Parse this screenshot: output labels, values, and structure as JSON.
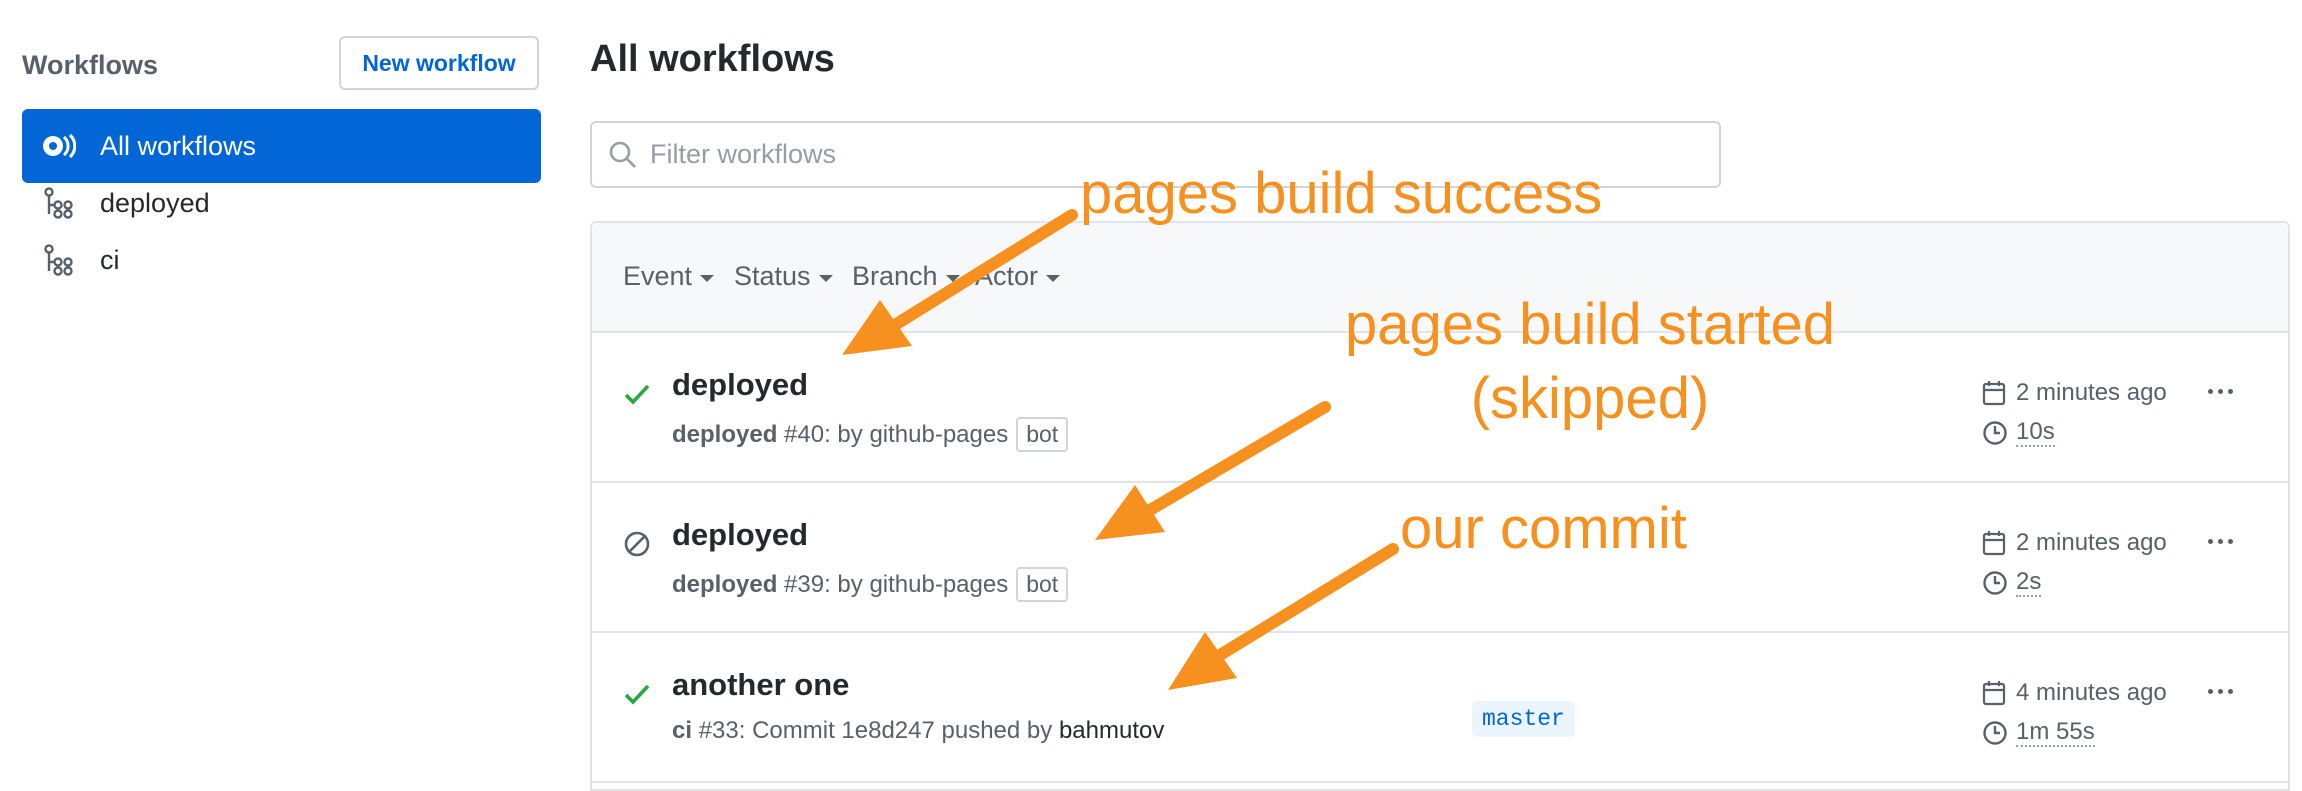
{
  "sidebar": {
    "title": "Workflows",
    "new_workflow_label": "New workflow",
    "items": [
      {
        "label": "All workflows",
        "icon": "workflows-icon",
        "active": true
      },
      {
        "label": "deployed",
        "icon": "workflow-icon",
        "active": false
      },
      {
        "label": "ci",
        "icon": "workflow-icon",
        "active": false
      }
    ]
  },
  "main": {
    "title": "All workflows",
    "filter_placeholder": "Filter workflows",
    "filters": [
      "Event",
      "Status",
      "Branch",
      "Actor"
    ],
    "runs": [
      {
        "status": "success",
        "title": "deployed",
        "workflow": "deployed",
        "run_number": "#40",
        "meta_text": ": by ",
        "actor": "github-pages",
        "badge": "bot",
        "branch": "",
        "time_ago": "2 minutes ago",
        "duration": "10s"
      },
      {
        "status": "skipped",
        "title": "deployed",
        "workflow": "deployed",
        "run_number": "#39",
        "meta_text": ": by ",
        "actor": "github-pages",
        "badge": "bot",
        "branch": "",
        "time_ago": "2 minutes ago",
        "duration": "2s"
      },
      {
        "status": "success",
        "title": "another one",
        "workflow": "ci",
        "run_number": "#33",
        "meta_text": ": Commit ",
        "commit": "1e8d247",
        "pushed_by_text": " pushed by ",
        "actor": "bahmutov",
        "badge": "",
        "branch": "master",
        "time_ago": "4 minutes ago",
        "duration": "1m 55s"
      }
    ]
  },
  "annotations": {
    "a1": "pages build success",
    "a2_line1": "pages build started",
    "a2_line2": "(skipped)",
    "a3": "our commit"
  },
  "colors": {
    "accent": "#0366d6",
    "success": "#28a745",
    "annotation": "#f6901e"
  }
}
